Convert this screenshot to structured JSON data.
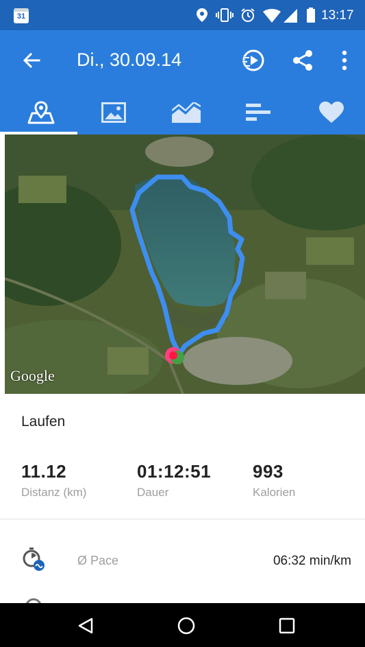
{
  "status_bar": {
    "calendar_day": "31",
    "time": "13:17"
  },
  "app_bar": {
    "title": "Di., 30.09.14"
  },
  "tabs": [
    {
      "icon": "map-pin-icon",
      "selected": true
    },
    {
      "icon": "image-icon",
      "selected": false
    },
    {
      "icon": "chart-icon",
      "selected": false
    },
    {
      "icon": "bar-list-icon",
      "selected": false
    },
    {
      "icon": "heart-icon",
      "selected": false
    }
  ],
  "map": {
    "attribution": "Google"
  },
  "activity": {
    "type": "Laufen",
    "stats": [
      {
        "value": "11.12",
        "label": "Distanz (km)"
      },
      {
        "value": "01:12:51",
        "label": "Dauer"
      },
      {
        "value": "993",
        "label": "Kalorien"
      }
    ],
    "details": [
      {
        "icon": "pace-icon",
        "label": "Ø Pace",
        "value": "06:32 min/km"
      }
    ]
  },
  "colors": {
    "status_bar": "#1e64b8",
    "app_bar": "#2a7ddc",
    "route": "#3d8ef0"
  }
}
